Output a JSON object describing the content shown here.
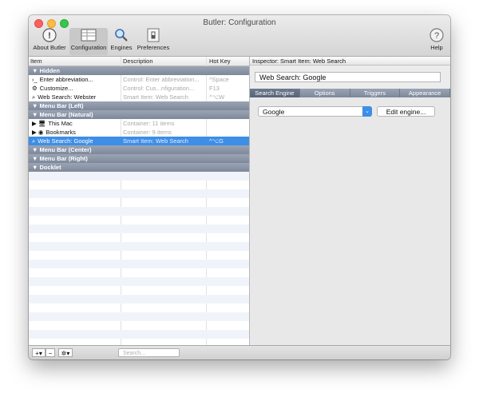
{
  "window": {
    "title": "Butler: Configuration"
  },
  "toolbar": {
    "about": "About Butler",
    "configuration": "Configuration",
    "engines": "Engines",
    "preferences": "Preferences",
    "help": "Help"
  },
  "columns": {
    "item": "Item",
    "description": "Description",
    "hotkey": "Hot Key"
  },
  "rows": [
    {
      "type": "section",
      "label": "▼ Hidden"
    },
    {
      "type": "item",
      "icon": "›_",
      "label": "Enter abbreviation...",
      "description": "Control: Enter abbreviation...",
      "hotkey": "^Space"
    },
    {
      "type": "item",
      "icon": "⚙",
      "label": "Customize...",
      "description": "Control: Cus...nfiguration...",
      "hotkey": "F13"
    },
    {
      "type": "item",
      "icon": "⌕",
      "label": "Web Search: Webster",
      "description": "Smart Item: Web Search",
      "hotkey": "^⌥W"
    },
    {
      "type": "section",
      "label": "▼ Menu Bar (Left)"
    },
    {
      "type": "section",
      "label": "▼ Menu Bar (Natural)"
    },
    {
      "type": "item",
      "icon": "▶ 🖥",
      "label": "This Mac",
      "description": "Container: 11 items",
      "hotkey": ""
    },
    {
      "type": "item",
      "icon": "▶ ◉",
      "label": "Bookmarks",
      "description": "Container: 9 items",
      "hotkey": ""
    },
    {
      "type": "item",
      "icon": "⌕",
      "label": "Web Search: Google",
      "description": "Smart Item: Web Search",
      "hotkey": "^⌥G",
      "selected": true
    },
    {
      "type": "section",
      "label": "▼ Menu Bar (Center)"
    },
    {
      "type": "section",
      "label": "▼ Menu Bar (Right)"
    },
    {
      "type": "section",
      "label": "▼ Docklet"
    }
  ],
  "inspector": {
    "header": "Inspector: Smart Item: Web Search",
    "name": "Web Search: Google",
    "tabs": [
      "Search Engine",
      "Options",
      "Triggers",
      "Appearance"
    ],
    "engine": "Google",
    "edit_button": "Edit engine..."
  },
  "bottombar": {
    "add": "+▾",
    "remove": "−",
    "action": "✲▾",
    "search_placeholder": "Search..."
  }
}
